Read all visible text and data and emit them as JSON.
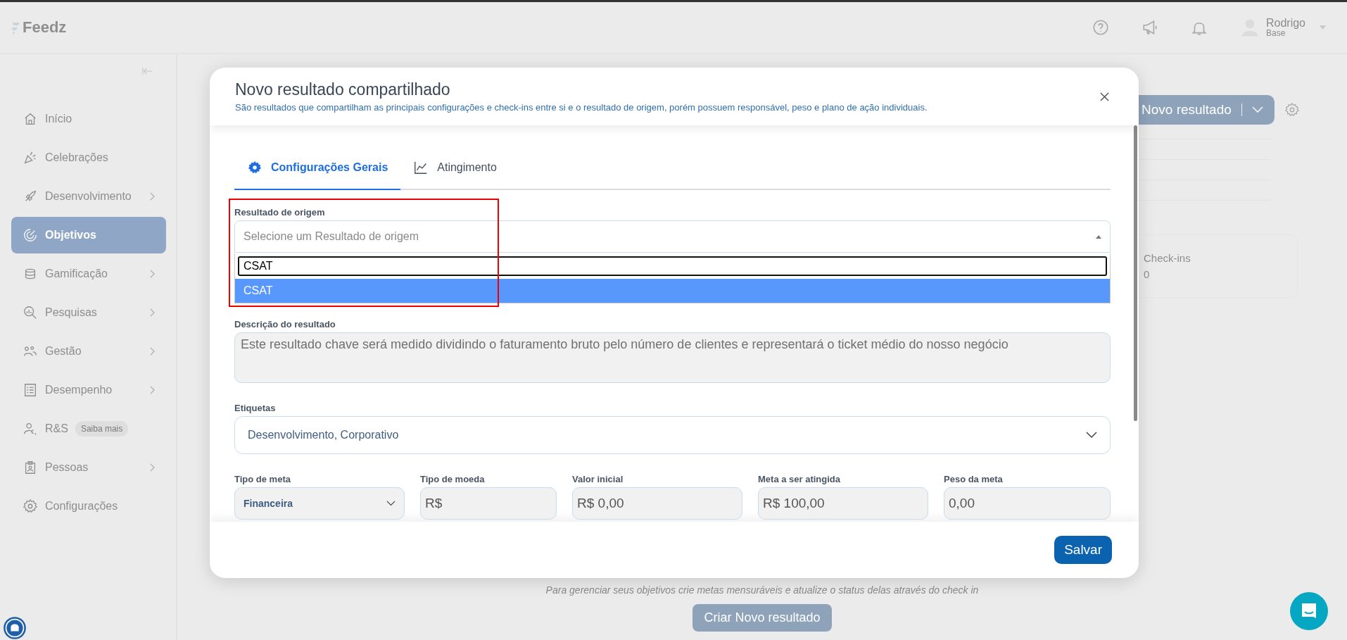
{
  "app": {
    "logo": "Feedz"
  },
  "header": {
    "user_name": "Rodrigo",
    "user_role": "Base"
  },
  "sidebar": {
    "items": [
      {
        "label": "Início",
        "expandable": false,
        "selected": false
      },
      {
        "label": "Celebrações",
        "expandable": false,
        "selected": false
      },
      {
        "label": "Desenvolvimento",
        "expandable": true,
        "selected": false
      },
      {
        "label": "Objetivos",
        "expandable": false,
        "selected": true
      },
      {
        "label": "Gamificação",
        "expandable": true,
        "selected": false
      },
      {
        "label": "Pesquisas",
        "expandable": true,
        "selected": false
      },
      {
        "label": "Gestão",
        "expandable": true,
        "selected": false
      },
      {
        "label": "Desempenho",
        "expandable": true,
        "selected": false
      },
      {
        "label": "R&S",
        "expandable": false,
        "selected": false,
        "badge": "Saiba mais"
      },
      {
        "label": "Pessoas",
        "expandable": true,
        "selected": false
      },
      {
        "label": "Configurações",
        "expandable": false,
        "selected": false
      }
    ]
  },
  "background": {
    "primary_button": "Novo resultado",
    "stat": {
      "label": "Check-ins",
      "value": "0"
    },
    "empty_hint": "Para gerenciar seus objetivos crie metas mensuráveis e atualize o status delas através do check in",
    "create_button": "Criar Novo resultado"
  },
  "modal": {
    "title": "Novo resultado compartilhado",
    "subtitle": "São resultados que compartilham as principais configurações e check-ins entre si e o resultado de origem, porém possuem responsável, peso e plano de ação individuais.",
    "tabs": [
      {
        "label": "Configurações Gerais",
        "selected": true
      },
      {
        "label": "Atingimento",
        "selected": false
      }
    ],
    "origin": {
      "label": "Resultado de origem",
      "placeholder": "Selecione um Resultado de origem",
      "expanded": true,
      "search": "CSAT",
      "options": [
        {
          "label": "CSAT",
          "selected": true
        }
      ]
    },
    "description": {
      "label": "Descrição do resultado",
      "value": "Este resultado chave será medido dividindo o faturamento bruto pelo número de clientes e representará o ticket médio do nosso negócio"
    },
    "tags": {
      "label": "Etiquetas",
      "value": "Desenvolvimento, Corporativo"
    },
    "fields": [
      {
        "label": "Tipo de meta",
        "value": "Financeira",
        "kind": "select"
      },
      {
        "label": "Tipo de moeda",
        "value": "R$",
        "kind": "text"
      },
      {
        "label": "Valor inicial",
        "value": "R$ 0,00",
        "kind": "text"
      },
      {
        "label": "Meta a ser atingida",
        "value": "R$ 100,00",
        "kind": "text"
      },
      {
        "label": "Peso da meta",
        "value": "0,00",
        "kind": "text"
      }
    ],
    "save_button": "Salvar"
  }
}
